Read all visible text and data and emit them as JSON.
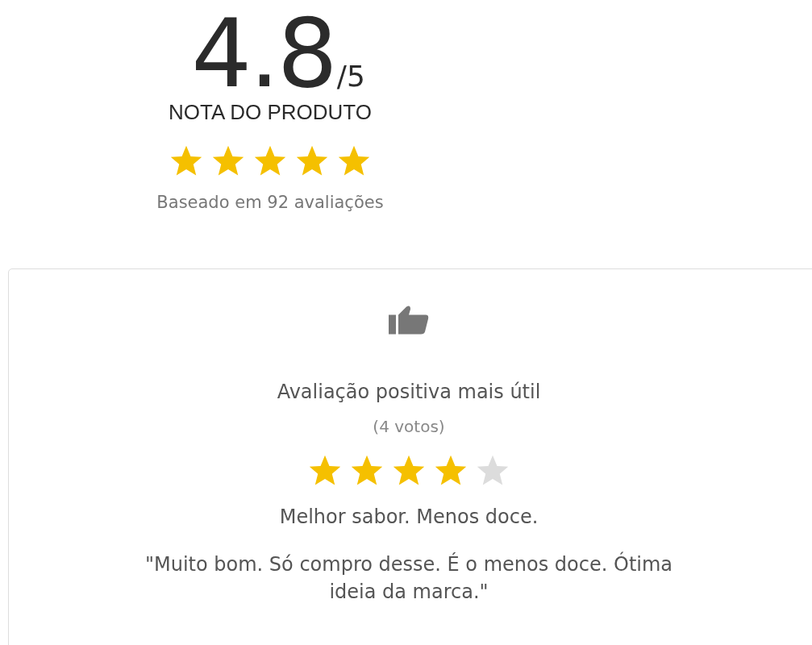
{
  "summary": {
    "score": "4.8",
    "scale": "/5",
    "label": "NOTA DO PRODUTO",
    "stars": 5,
    "based_on": "Baseado em 92 avaliações"
  },
  "top_review": {
    "heading": "Avaliação positiva mais útil",
    "votes": "(4 votos)",
    "stars": 4,
    "title": "Melhor sabor. Menos doce.",
    "quote": "\"Muito bom. Só compro desse. É o menos doce. Ótima ideia da marca.\""
  }
}
